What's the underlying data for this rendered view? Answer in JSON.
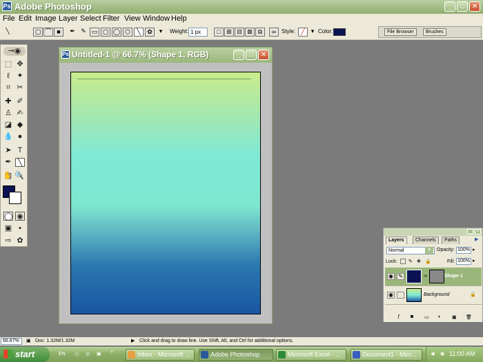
{
  "app": {
    "title": "Adobe Photoshop",
    "icon": "photoshop-icon"
  },
  "window_controls": {
    "minimize": "_",
    "maximize": "□",
    "close": "✕"
  },
  "menu": [
    "File",
    "Edit",
    "Image",
    "Layer",
    "Select",
    "Filter",
    "View",
    "Window",
    "Help"
  ],
  "options": {
    "weight_label": "Weight:",
    "weight_value": "1 px",
    "style_label": "Style:",
    "color_label": "Color:",
    "color_value": "#0b1254"
  },
  "palette_well": {
    "tabs": [
      "File Browser",
      "Brushes"
    ]
  },
  "toolbox": {
    "foreground_color": "#0b1254",
    "background_color": "#ffffff"
  },
  "document": {
    "title": "Untitled-1 @ 66.7% (Shape 1, RGB)"
  },
  "layers_panel": {
    "tabs": [
      "Layers",
      "Channels",
      "Paths"
    ],
    "blend_mode": "Normal",
    "opacity_label": "Opacity:",
    "opacity_value": "100%",
    "lock_label": "Lock:",
    "fill_label": "Fill:",
    "fill_value": "100%",
    "layers": [
      {
        "name": "Shape 1",
        "selected": true
      },
      {
        "name": "Background",
        "selected": false
      }
    ]
  },
  "status": {
    "zoom": "66.67%",
    "doc_info": "Doc: 1.32M/1.32M",
    "hint": "Click and drag to draw line.  Use Shift, Alt, and Ctrl for additional options."
  },
  "taskbar": {
    "start_label": "start",
    "lang": "EN",
    "tasks": [
      {
        "label": "Inbox - Microsoft ...",
        "icon": "outlook-icon",
        "active": false
      },
      {
        "label": "Adobe Photoshop",
        "icon": "photoshop-icon",
        "active": true
      },
      {
        "label": "Microsoft Excel - ...",
        "icon": "excel-icon",
        "active": false
      },
      {
        "label": "Document1 - Micr...",
        "icon": "word-icon",
        "active": false
      }
    ],
    "clock": "11:00 AM"
  }
}
